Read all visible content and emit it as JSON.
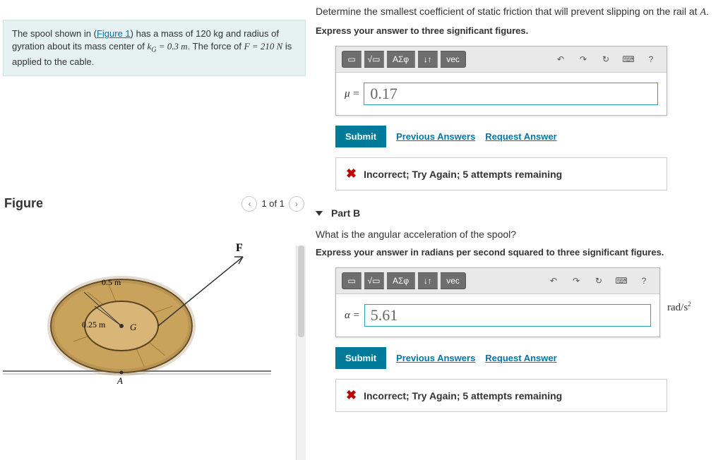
{
  "problem": {
    "pre": "The spool shown in (",
    "figlink": "Figure 1",
    "post": ") has a mass of 120 kg and radius of gyration about its mass center of ",
    "kg": "k_G = 0.3 m",
    "mid": ". The force of ",
    "force": "F = 210 N",
    "tail": " is applied to the cable."
  },
  "figure": {
    "title": "Figure",
    "pager": "1 of 1",
    "F": "F",
    "r_outer": "0.5 m",
    "r_inner": "0.25 m",
    "G": "G",
    "A": "A"
  },
  "partA": {
    "prompt": "Determine the smallest coefficient of static friction that will prevent slipping on the rail at ",
    "promptvar": "A",
    "promptend": ".",
    "instr": "Express your answer to three significant figures.",
    "var": "μ =",
    "value": "0.17",
    "submit": "Submit",
    "prev": "Previous Answers",
    "req": "Request Answer",
    "feedback": "Incorrect; Try Again; 5 attempts remaining"
  },
  "partB": {
    "label": "Part B",
    "prompt": "What is the angular acceleration of the spool?",
    "instr": "Express your answer in radians per second squared to three significant figures.",
    "var": "α =",
    "value": "5.61",
    "unit": "rad/s²",
    "submit": "Submit",
    "prev": "Previous Answers",
    "req": "Request Answer",
    "feedback": "Incorrect; Try Again; 5 attempts remaining"
  },
  "toolbar": {
    "templates": "ΑΣφ",
    "vec": "vec",
    "help": "?"
  }
}
